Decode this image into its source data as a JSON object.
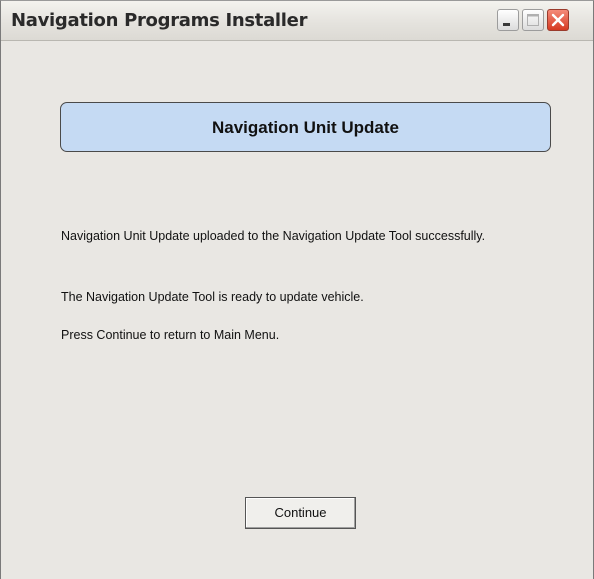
{
  "window": {
    "title": "Navigation Programs Installer",
    "controls": {
      "minimize_icon": "minimize-icon",
      "maximize_icon": "maximize-icon",
      "close_icon": "close-icon",
      "close_color": "#d63a22"
    }
  },
  "header": {
    "title": "Navigation Unit Update",
    "background": "#c5daf3"
  },
  "messages": [
    "Navigation Unit Update uploaded to the Navigation Update Tool successfully.",
    "The Navigation Update Tool is ready to update vehicle.",
    "Press Continue to return to Main Menu."
  ],
  "actions": {
    "continue_label": "Continue"
  }
}
